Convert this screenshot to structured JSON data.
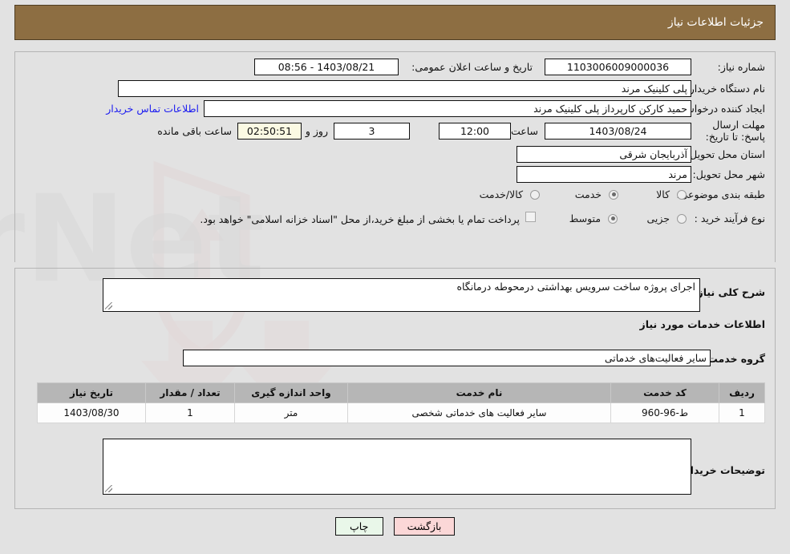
{
  "header": {
    "title": "جزئیات اطلاعات نیاز",
    "bar_color": "#8d6e42"
  },
  "form": {
    "need_number_label": "شماره نیاز:",
    "need_number_value": "1103006009000036",
    "announce_label": "تاریخ و ساعت اعلان عمومی:",
    "announce_value": "1403/08/21 - 08:56",
    "buyer_org_label": "نام دستگاه خریدار:",
    "buyer_org_value": "پلی کلینیک مرند",
    "creator_label": "ایجاد کننده درخواست:",
    "creator_value": "حمید کارکن کارپرداز پلی کلینیک مرند",
    "contact_link": "اطلاعات تماس خریدار",
    "deadline_label": "مهلت ارسال پاسخ: تا تاریخ:",
    "deadline_date": "1403/08/24",
    "hour_label": "ساعت",
    "deadline_time": "12:00",
    "days_value": "3",
    "days_label": "روز و",
    "remaining_value": "02:50:51",
    "remaining_label": "ساعت باقی مانده",
    "province_label": "استان محل تحویل:",
    "province_value": "آذربایجان شرقی",
    "city_label": "شهر محل تحویل:",
    "city_value": "مرند",
    "category_label": "طبقه بندی موضوعی:",
    "category_options": [
      {
        "label": "کالا",
        "selected": false
      },
      {
        "label": "خدمت",
        "selected": true
      },
      {
        "label": "کالا/خدمت",
        "selected": false
      }
    ],
    "process_label": "نوع فرآیند خرید :",
    "process_options": [
      {
        "label": "جزیی",
        "selected": false
      },
      {
        "label": "متوسط",
        "selected": true
      }
    ],
    "treasury_note": "پرداخت تمام یا بخشی از مبلغ خرید،از محل \"اسناد خزانه اسلامی\" خواهد بود.",
    "treasury_checked": false
  },
  "details": {
    "general_desc_label": "شرح کلی نیاز:",
    "general_desc_value": "اجرای پروژه ساخت سرویس بهداشتی درمحوطه درمانگاه",
    "services_section_title": "اطلاعات خدمات مورد نیاز",
    "service_group_label": "گروه خدمت:",
    "service_group_value": "سایر فعالیت‌های خدماتی",
    "buyer_notes_label": "توضیحات خریدار:",
    "buyer_notes_value": ""
  },
  "table": {
    "columns": [
      "ردیف",
      "کد خدمت",
      "نام خدمت",
      "واحد اندازه گیری",
      "تعداد / مقدار",
      "تاریخ نیاز"
    ],
    "rows": [
      {
        "row": "1",
        "code": "ط-96-960",
        "name": "سایر فعالیت های خدماتی شخصی",
        "unit": "متر",
        "qty": "1",
        "date": "1403/08/30"
      }
    ]
  },
  "footer": {
    "print_label": "چاپ",
    "back_label": "بازگشت",
    "print_color": "#e9f7e9",
    "back_color": "#fbd7d7"
  },
  "watermark": {
    "text": "AriaTender.net"
  }
}
